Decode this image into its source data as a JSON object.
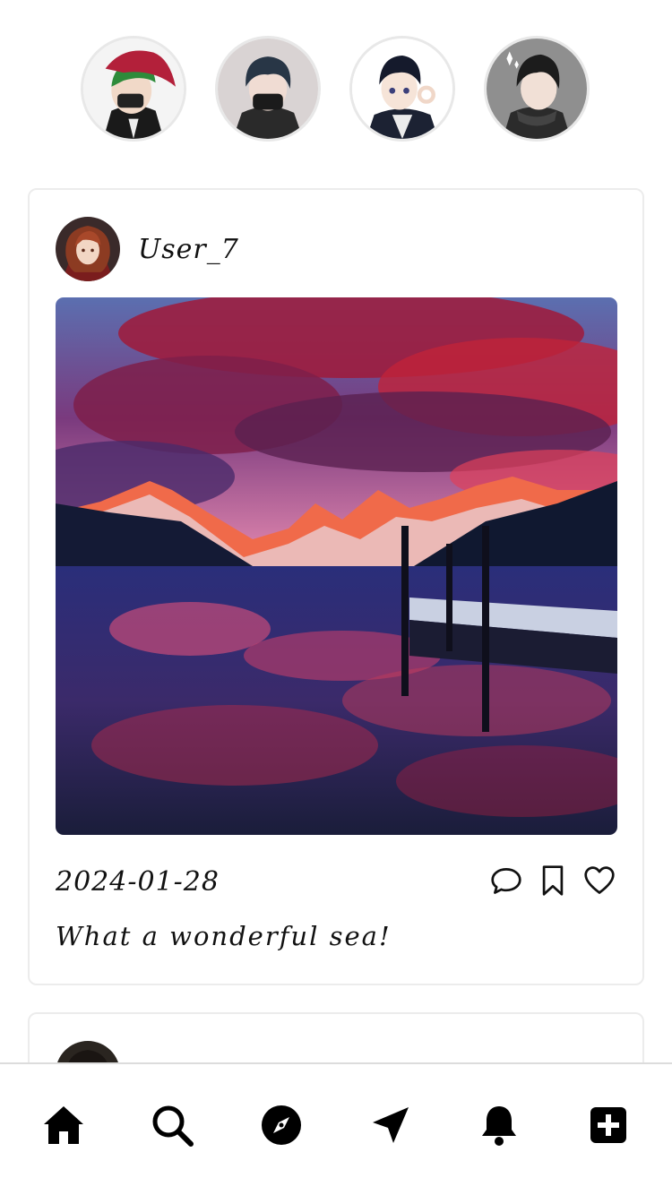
{
  "stories": [
    {
      "name": "story-1",
      "icon": "avatar-red-cap"
    },
    {
      "name": "story-2",
      "icon": "avatar-masked"
    },
    {
      "name": "story-3",
      "icon": "avatar-ok-sign"
    },
    {
      "name": "story-4",
      "icon": "avatar-scarf"
    }
  ],
  "posts": [
    {
      "username": "User_7",
      "date": "2024-01-28",
      "caption": "What a wonderful sea!",
      "image_icon": "mountain-lake-sunset"
    }
  ],
  "actions": {
    "comment_icon": "comment-icon",
    "bookmark_icon": "bookmark-icon",
    "like_icon": "heart-icon"
  },
  "nav": [
    {
      "icon": "home-icon"
    },
    {
      "icon": "search-icon"
    },
    {
      "icon": "compass-icon"
    },
    {
      "icon": "send-icon"
    },
    {
      "icon": "bell-icon"
    },
    {
      "icon": "plus-square-icon"
    }
  ]
}
